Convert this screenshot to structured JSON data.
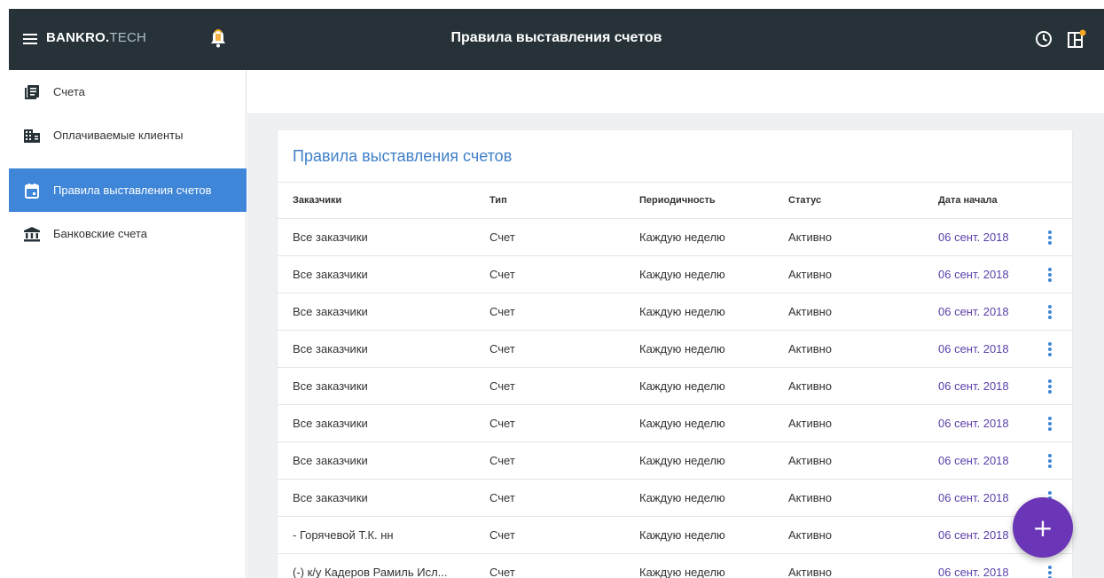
{
  "header": {
    "brand_main": "BANKRO.",
    "brand_tld": "TECH",
    "title": "Правила выставления счетов",
    "icons": [
      "menu-icon",
      "bell-icon",
      "clock-icon",
      "panel-icon"
    ]
  },
  "sidebar": {
    "items": [
      {
        "label": "Счета",
        "icon": "invoices-icon"
      },
      {
        "label": "Оплачиваемые клиенты",
        "icon": "building-icon"
      },
      {
        "label": "Правила выставления счетов",
        "icon": "calendar-icon",
        "active": true
      },
      {
        "label": "Банковские счета",
        "icon": "bank-icon"
      }
    ]
  },
  "main": {
    "card_title": "Правила выставления счетов",
    "columns": [
      "Заказчики",
      "Тип",
      "Периодичность",
      "Статус",
      "Дата начала"
    ],
    "rows": [
      [
        "Все заказчики",
        "Счет",
        "Каждую неделю",
        "Активно",
        "06 сент. 2018"
      ],
      [
        "Все заказчики",
        "Счет",
        "Каждую неделю",
        "Активно",
        "06 сент. 2018"
      ],
      [
        "Все заказчики",
        "Счет",
        "Каждую неделю",
        "Активно",
        "06 сент. 2018"
      ],
      [
        "Все заказчики",
        "Счет",
        "Каждую неделю",
        "Активно",
        "06 сент. 2018"
      ],
      [
        "Все заказчики",
        "Счет",
        "Каждую неделю",
        "Активно",
        "06 сент. 2018"
      ],
      [
        "Все заказчики",
        "Счет",
        "Каждую неделю",
        "Активно",
        "06 сент. 2018"
      ],
      [
        "Все заказчики",
        "Счет",
        "Каждую неделю",
        "Активно",
        "06 сент. 2018"
      ],
      [
        "Все заказчики",
        "Счет",
        "Каждую неделю",
        "Активно",
        "06 сент. 2018"
      ],
      [
        "- Горячевой Т.К. нн",
        "Счет",
        "Каждую неделю",
        "Активно",
        "06 сент. 2018"
      ],
      [
        "(-) к/у Кадеров Рамиль Исл...",
        "Счет",
        "Каждую неделю",
        "Активно",
        "06 сент. 2018"
      ]
    ],
    "fab_label": "+"
  },
  "colors": {
    "header_bg": "#263238",
    "active_nav": "#3f86d8",
    "title_blue": "#3f7fc8",
    "date_purple": "#5b3fa8",
    "fab": "#6a35b6",
    "notification_dot": "#f5a623"
  }
}
